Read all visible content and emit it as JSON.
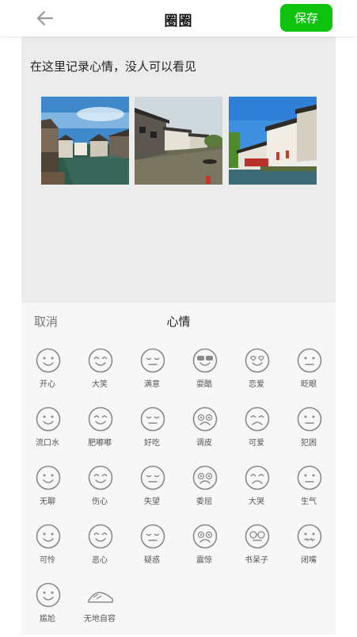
{
  "header": {
    "title": "圈圈",
    "save_label": "保存"
  },
  "content": {
    "prompt": "在这里记录心情，没人可以看见"
  },
  "mood_panel": {
    "cancel_label": "取消",
    "title": "心情",
    "moods": [
      {
        "label": "开心",
        "icon": "happy-face-icon"
      },
      {
        "label": "大笑",
        "icon": "laugh-face-icon"
      },
      {
        "label": "满意",
        "icon": "satisfied-face-icon"
      },
      {
        "label": "耍酷",
        "icon": "cool-face-icon"
      },
      {
        "label": "恋爱",
        "icon": "in-love-face-icon"
      },
      {
        "label": "眨眼",
        "icon": "wink-face-icon"
      },
      {
        "label": "流口水",
        "icon": "drool-face-icon"
      },
      {
        "label": "肥嘟嘟",
        "icon": "chubby-face-icon"
      },
      {
        "label": "好吃",
        "icon": "yummy-face-icon"
      },
      {
        "label": "调皮",
        "icon": "naughty-face-icon"
      },
      {
        "label": "可爱",
        "icon": "cute-face-icon"
      },
      {
        "label": "犯困",
        "icon": "sleepy-face-icon"
      },
      {
        "label": "无聊",
        "icon": "bored-face-icon"
      },
      {
        "label": "伤心",
        "icon": "sad-face-icon"
      },
      {
        "label": "失望",
        "icon": "disappointed-face-icon"
      },
      {
        "label": "委屈",
        "icon": "aggrieved-face-icon"
      },
      {
        "label": "大哭",
        "icon": "crying-face-icon"
      },
      {
        "label": "生气",
        "icon": "angry-face-icon"
      },
      {
        "label": "可怜",
        "icon": "pitiful-face-icon"
      },
      {
        "label": "恶心",
        "icon": "disgusted-face-icon"
      },
      {
        "label": "疑惑",
        "icon": "confused-face-icon"
      },
      {
        "label": "震惊",
        "icon": "shocked-face-icon"
      },
      {
        "label": "书呆子",
        "icon": "nerd-face-icon"
      },
      {
        "label": "闭嘴",
        "icon": "mouth-shut-face-icon"
      },
      {
        "label": "尴尬",
        "icon": "awkward-face-icon"
      },
      {
        "label": "无地自容",
        "icon": "ashamed-face-icon"
      }
    ]
  },
  "colors": {
    "accent": "#0dc30d",
    "content_bg": "#ececec",
    "panel_bg": "#f7f7f7",
    "icon_stroke": "#8a8a8a"
  }
}
